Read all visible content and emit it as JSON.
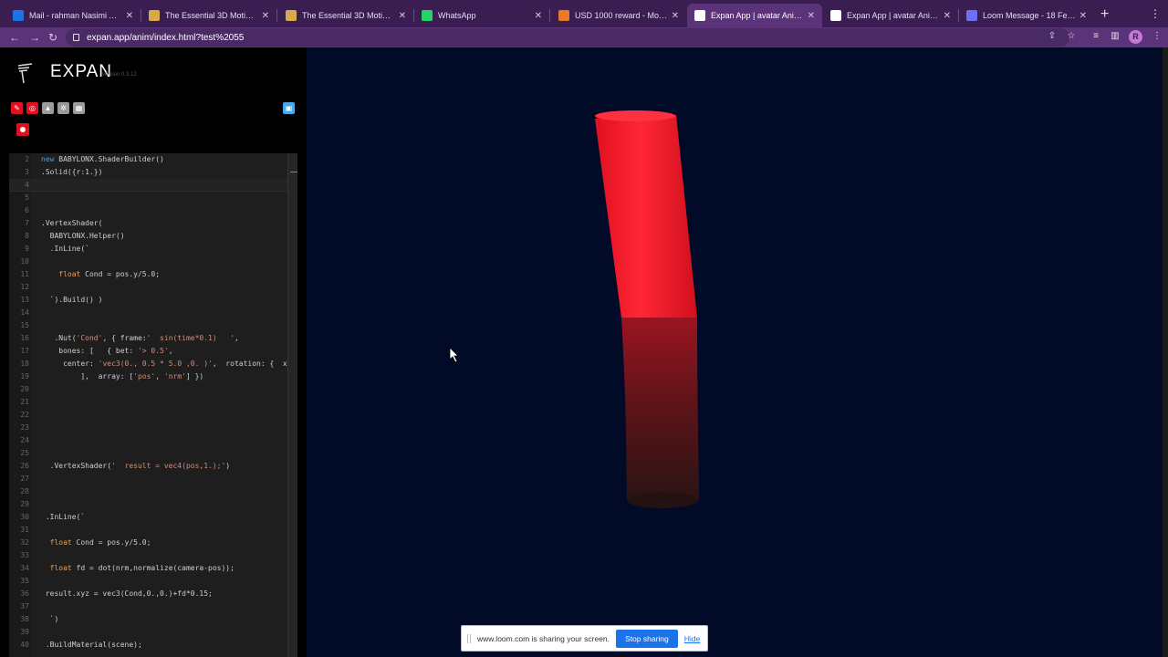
{
  "browser": {
    "tabs": [
      {
        "label": "Mail - rahman Nasimi Asl - O",
        "icon": "outlook-icon",
        "color": "#1a73e8"
      },
      {
        "label": "The Essential 3D Motion De",
        "icon": "course-icon",
        "color": "#d9a84a"
      },
      {
        "label": "The Essential 3D Motion De",
        "icon": "course-icon",
        "color": "#d9a84a"
      },
      {
        "label": "WhatsApp",
        "icon": "whatsapp-icon",
        "color": "#25d366"
      },
      {
        "label": "USD 1000 reward - Moving I",
        "icon": "reward-icon",
        "color": "#e87a2a"
      },
      {
        "label": "Expan App | avatar Animatio",
        "icon": "globe-icon",
        "color": "#ffffff"
      },
      {
        "label": "Expan App | avatar Animatio",
        "icon": "globe-icon",
        "color": "#ffffff"
      },
      {
        "label": "Loom Message - 18 Februar",
        "icon": "loom-icon",
        "color": "#6f6ff5"
      }
    ],
    "active_tab_index": 5,
    "new_tab_symbol": "+",
    "url": "expan.app/anim/index.html?test%2055",
    "profile_initial": "R"
  },
  "app": {
    "name": "EXPAN",
    "version": "version 0.3.12",
    "toolbar_icons": [
      {
        "name": "edit-icon",
        "color": "#e01020"
      },
      {
        "name": "target-icon",
        "color": "#e01020"
      },
      {
        "name": "layers-icon",
        "color": "#9a9a9a"
      },
      {
        "name": "settings-icon",
        "color": "#9a9a9a"
      },
      {
        "name": "grid-icon",
        "color": "#9a9a9a"
      }
    ],
    "save_icon": "save-icon",
    "record_icon": "record-icon"
  },
  "editor": {
    "lines": [
      {
        "n": "2",
        "text": "new BABYLONX.ShaderBuilder()"
      },
      {
        "n": "3",
        "text": ".Solid({r:1.})"
      },
      {
        "n": "4",
        "text": ""
      },
      {
        "n": "5",
        "text": ""
      },
      {
        "n": "6",
        "text": ""
      },
      {
        "n": "7",
        "text": ".VertexShader("
      },
      {
        "n": "8",
        "text": "  BABYLONX.Helper()"
      },
      {
        "n": "9",
        "text": "  .InLine(`"
      },
      {
        "n": "10",
        "text": ""
      },
      {
        "n": "11",
        "text": "    float Cond = pos.y/5.0;"
      },
      {
        "n": "12",
        "text": ""
      },
      {
        "n": "13",
        "text": "  `).Build() )"
      },
      {
        "n": "14",
        "text": ""
      },
      {
        "n": "15",
        "text": ""
      },
      {
        "n": "16",
        "text": "   .Nut('Cond', { frame:'  sin(time*0.1)   ',"
      },
      {
        "n": "17",
        "text": "    bones: [   { bet: '> 0.5',"
      },
      {
        "n": "18",
        "text": "     center: 'vec3(0., 0.5 * 5.0 ,0. )',  rotation: {  x: '"
      },
      {
        "n": "19",
        "text": "         ],  array: ['pos', 'nrm'] })"
      },
      {
        "n": "20",
        "text": ""
      },
      {
        "n": "21",
        "text": ""
      },
      {
        "n": "22",
        "text": ""
      },
      {
        "n": "23",
        "text": ""
      },
      {
        "n": "24",
        "text": ""
      },
      {
        "n": "25",
        "text": ""
      },
      {
        "n": "26",
        "text": "  .VertexShader('  result = vec4(pos,1.);')"
      },
      {
        "n": "27",
        "text": ""
      },
      {
        "n": "28",
        "text": ""
      },
      {
        "n": "29",
        "text": ""
      },
      {
        "n": "30",
        "text": " .InLine(`"
      },
      {
        "n": "31",
        "text": ""
      },
      {
        "n": "32",
        "text": "  float Cond = pos.y/5.0;"
      },
      {
        "n": "33",
        "text": ""
      },
      {
        "n": "34",
        "text": "  float fd = dot(nrm,normalize(camera-pos));"
      },
      {
        "n": "35",
        "text": ""
      },
      {
        "n": "36",
        "text": " result.xyz = vec3(Cond,0.,0.)+fd*0.15;"
      },
      {
        "n": "37",
        "text": ""
      },
      {
        "n": "38",
        "text": "  `)"
      },
      {
        "n": "39",
        "text": ""
      },
      {
        "n": "40",
        "text": " .BuildMaterial(scene);"
      }
    ],
    "current_line": "4"
  },
  "viewport": {
    "background": "#010b28",
    "object_top_color": "#ff1a2a",
    "object_bottom_color": "#2a1414"
  },
  "loom": {
    "message": "www.loom.com is sharing your screen.",
    "stop_label": "Stop sharing",
    "hide_label": "Hide"
  }
}
